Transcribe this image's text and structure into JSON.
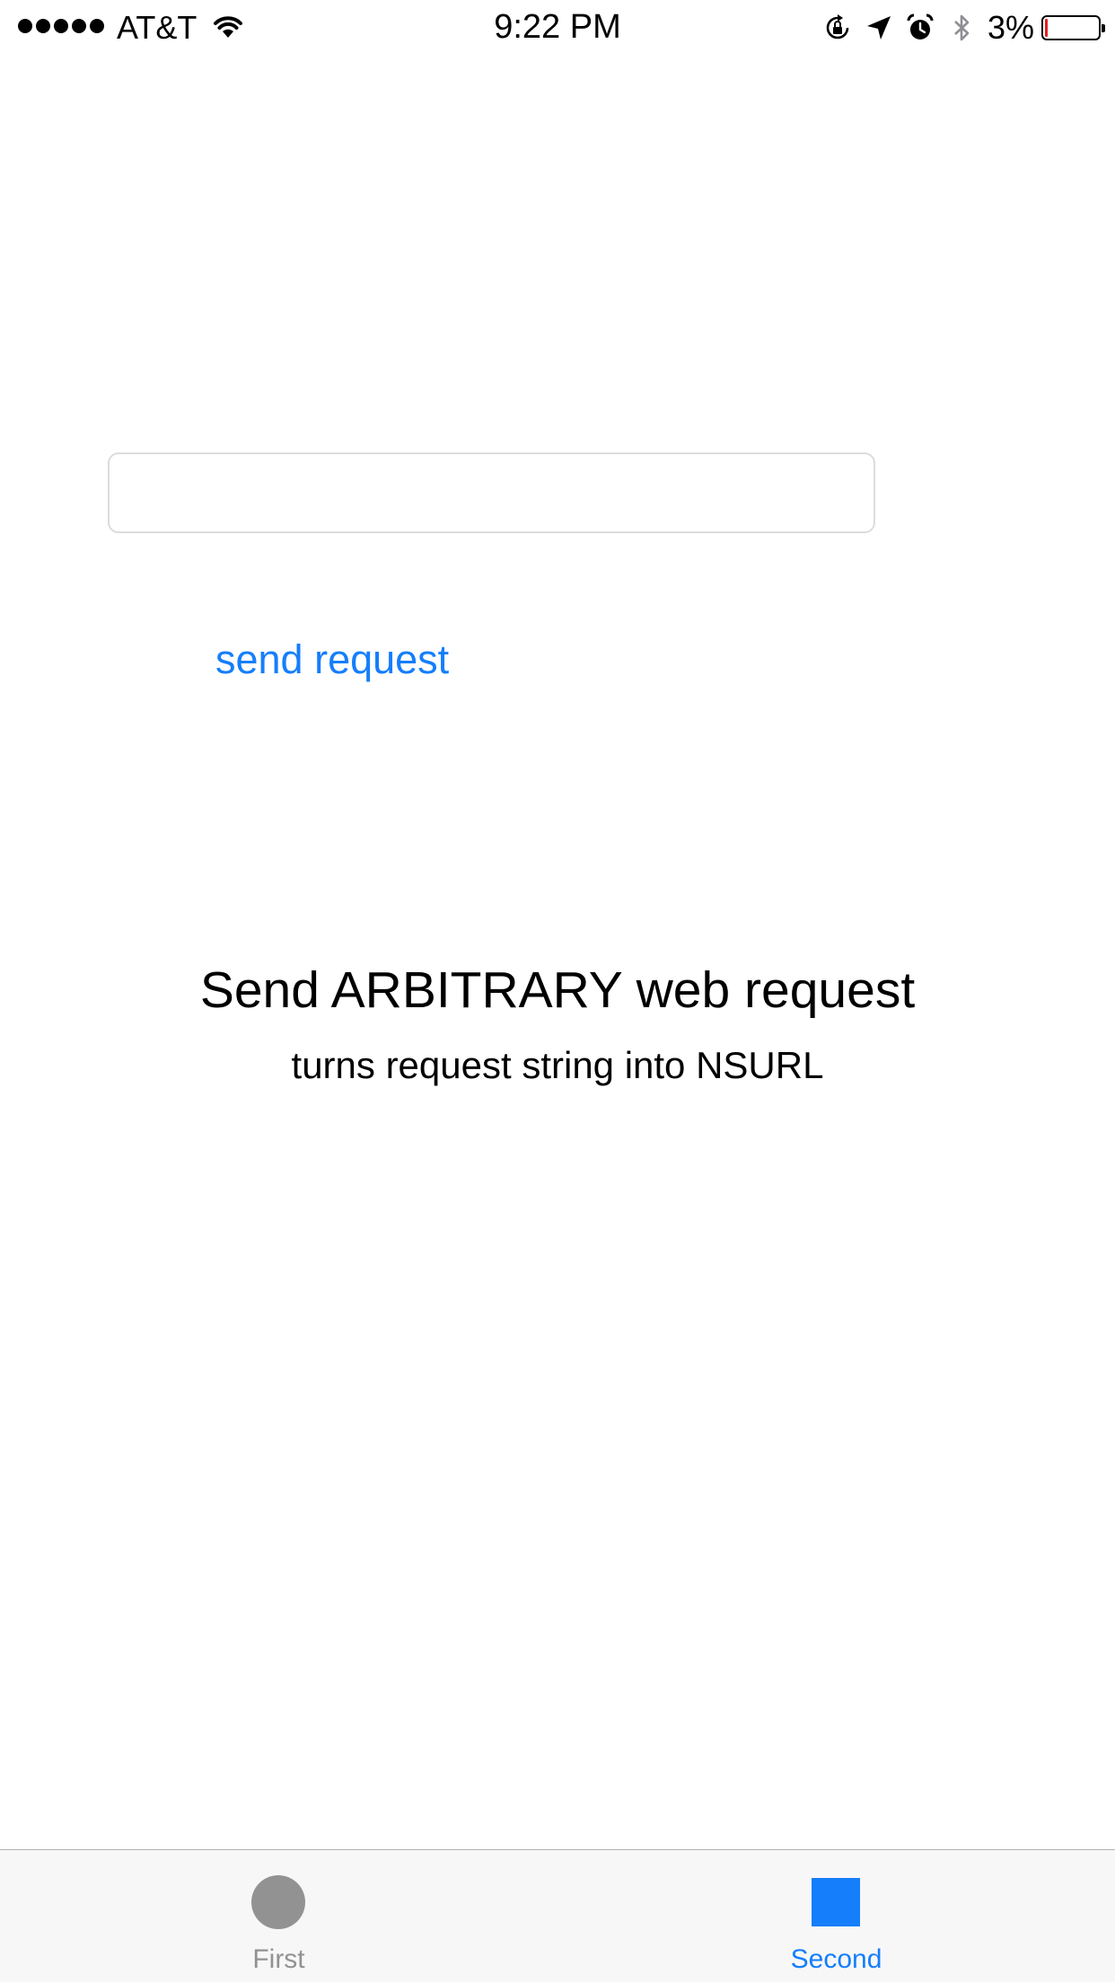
{
  "status_bar": {
    "carrier": "AT&T",
    "time": "9:22 PM",
    "battery_percent": "3%",
    "battery_level": 0.03,
    "battery_fill_color": "#e02020",
    "signal_bars": 5,
    "icons": [
      "wifi-icon",
      "rotation-lock-icon",
      "location-arrow-icon",
      "alarm-icon",
      "bluetooth-icon",
      "battery-icon"
    ]
  },
  "form": {
    "url_value": "",
    "url_placeholder": "",
    "send_label": "send request"
  },
  "content": {
    "title": "Send ARBITRARY web request",
    "subtitle": "turns request string into NSURL"
  },
  "tab_bar": {
    "tabs": [
      {
        "label": "First",
        "icon": "circle-icon",
        "selected": false,
        "color": "#929292"
      },
      {
        "label": "Second",
        "icon": "square-icon",
        "selected": true,
        "color": "#157efb"
      }
    ]
  },
  "colors": {
    "accent": "#157efb",
    "inactive": "#929292",
    "tab_bar_bg": "#f7f7f7"
  }
}
